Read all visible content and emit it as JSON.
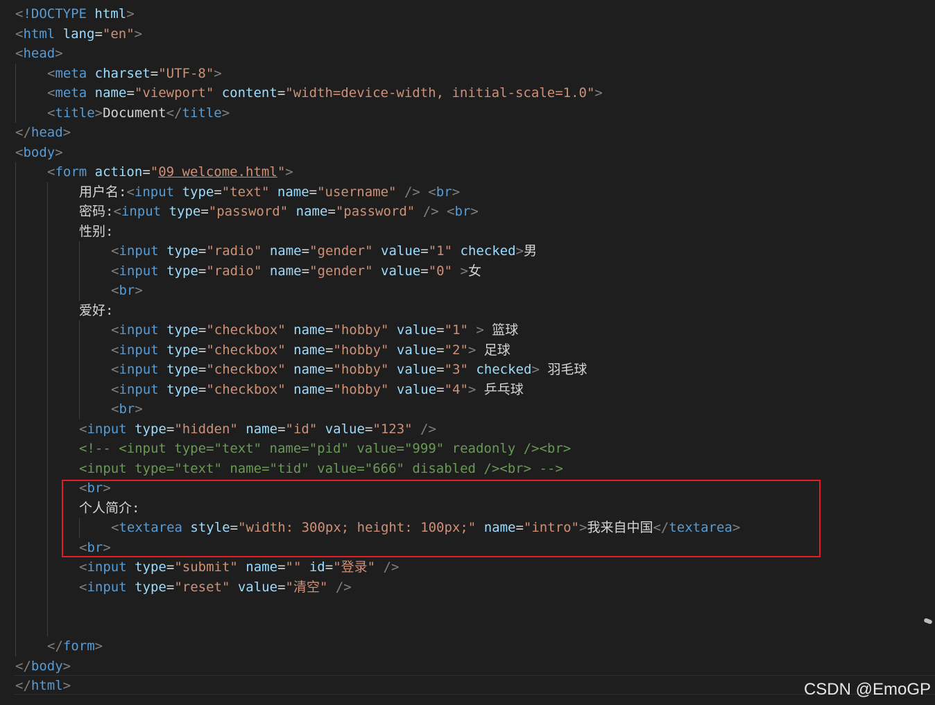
{
  "editor": {
    "lines": [
      {
        "indent": 0,
        "tokens": [
          [
            "p",
            "<"
          ],
          [
            "t",
            "!DOCTYPE"
          ],
          [
            "x",
            " "
          ],
          [
            "a",
            "html"
          ],
          [
            "p",
            ">"
          ]
        ]
      },
      {
        "indent": 0,
        "tokens": [
          [
            "p",
            "<"
          ],
          [
            "t",
            "html"
          ],
          [
            "x",
            " "
          ],
          [
            "a",
            "lang"
          ],
          [
            "x",
            "="
          ],
          [
            "s",
            "\"en\""
          ],
          [
            "p",
            ">"
          ]
        ]
      },
      {
        "indent": 0,
        "tokens": [
          [
            "p",
            "<"
          ],
          [
            "t",
            "head"
          ],
          [
            "p",
            ">"
          ]
        ]
      },
      {
        "indent": 1,
        "tokens": [
          [
            "p",
            "<"
          ],
          [
            "t",
            "meta"
          ],
          [
            "x",
            " "
          ],
          [
            "a",
            "charset"
          ],
          [
            "x",
            "="
          ],
          [
            "s",
            "\"UTF-8\""
          ],
          [
            "p",
            ">"
          ]
        ]
      },
      {
        "indent": 1,
        "tokens": [
          [
            "p",
            "<"
          ],
          [
            "t",
            "meta"
          ],
          [
            "x",
            " "
          ],
          [
            "a",
            "name"
          ],
          [
            "x",
            "="
          ],
          [
            "s",
            "\"viewport\""
          ],
          [
            "x",
            " "
          ],
          [
            "a",
            "content"
          ],
          [
            "x",
            "="
          ],
          [
            "s",
            "\"width=device-width, initial-scale=1.0\""
          ],
          [
            "p",
            ">"
          ]
        ]
      },
      {
        "indent": 1,
        "tokens": [
          [
            "p",
            "<"
          ],
          [
            "t",
            "title"
          ],
          [
            "p",
            ">"
          ],
          [
            "x",
            "Document"
          ],
          [
            "p",
            "</"
          ],
          [
            "t",
            "title"
          ],
          [
            "p",
            ">"
          ]
        ]
      },
      {
        "indent": 0,
        "tokens": [
          [
            "p",
            "</"
          ],
          [
            "t",
            "head"
          ],
          [
            "p",
            ">"
          ]
        ]
      },
      {
        "indent": 0,
        "tokens": [
          [
            "p",
            "<"
          ],
          [
            "t",
            "body"
          ],
          [
            "p",
            ">"
          ]
        ]
      },
      {
        "indent": 1,
        "tokens": [
          [
            "p",
            "<"
          ],
          [
            "t",
            "form"
          ],
          [
            "x",
            " "
          ],
          [
            "a",
            "action"
          ],
          [
            "x",
            "="
          ],
          [
            "s",
            "\""
          ],
          [
            "su",
            "09 welcome.html"
          ],
          [
            "s",
            "\""
          ],
          [
            "p",
            ">"
          ]
        ]
      },
      {
        "indent": 2,
        "tokens": [
          [
            "x",
            "用户名:"
          ],
          [
            "p",
            "<"
          ],
          [
            "t",
            "input"
          ],
          [
            "x",
            " "
          ],
          [
            "a",
            "type"
          ],
          [
            "x",
            "="
          ],
          [
            "s",
            "\"text\""
          ],
          [
            "x",
            " "
          ],
          [
            "a",
            "name"
          ],
          [
            "x",
            "="
          ],
          [
            "s",
            "\"username\""
          ],
          [
            "x",
            " "
          ],
          [
            "p",
            "/>"
          ],
          [
            "x",
            " "
          ],
          [
            "p",
            "<"
          ],
          [
            "t",
            "br"
          ],
          [
            "p",
            ">"
          ]
        ]
      },
      {
        "indent": 2,
        "tokens": [
          [
            "x",
            "密码:"
          ],
          [
            "p",
            "<"
          ],
          [
            "t",
            "input"
          ],
          [
            "x",
            " "
          ],
          [
            "a",
            "type"
          ],
          [
            "x",
            "="
          ],
          [
            "s",
            "\"password\""
          ],
          [
            "x",
            " "
          ],
          [
            "a",
            "name"
          ],
          [
            "x",
            "="
          ],
          [
            "s",
            "\"password\""
          ],
          [
            "x",
            " "
          ],
          [
            "p",
            "/>"
          ],
          [
            "x",
            " "
          ],
          [
            "p",
            "<"
          ],
          [
            "t",
            "br"
          ],
          [
            "p",
            ">"
          ]
        ]
      },
      {
        "indent": 2,
        "tokens": [
          [
            "x",
            "性别:"
          ]
        ]
      },
      {
        "indent": 3,
        "tokens": [
          [
            "p",
            "<"
          ],
          [
            "t",
            "input"
          ],
          [
            "x",
            " "
          ],
          [
            "a",
            "type"
          ],
          [
            "x",
            "="
          ],
          [
            "s",
            "\"radio\""
          ],
          [
            "x",
            " "
          ],
          [
            "a",
            "name"
          ],
          [
            "x",
            "="
          ],
          [
            "s",
            "\"gender\""
          ],
          [
            "x",
            " "
          ],
          [
            "a",
            "value"
          ],
          [
            "x",
            "="
          ],
          [
            "s",
            "\"1\""
          ],
          [
            "x",
            " "
          ],
          [
            "a",
            "checked"
          ],
          [
            "p",
            ">"
          ],
          [
            "x",
            "男"
          ]
        ]
      },
      {
        "indent": 3,
        "tokens": [
          [
            "p",
            "<"
          ],
          [
            "t",
            "input"
          ],
          [
            "x",
            " "
          ],
          [
            "a",
            "type"
          ],
          [
            "x",
            "="
          ],
          [
            "s",
            "\"radio\""
          ],
          [
            "x",
            " "
          ],
          [
            "a",
            "name"
          ],
          [
            "x",
            "="
          ],
          [
            "s",
            "\"gender\""
          ],
          [
            "x",
            " "
          ],
          [
            "a",
            "value"
          ],
          [
            "x",
            "="
          ],
          [
            "s",
            "\"0\""
          ],
          [
            "x",
            " "
          ],
          [
            "p",
            ">"
          ],
          [
            "x",
            "女"
          ]
        ]
      },
      {
        "indent": 3,
        "tokens": [
          [
            "p",
            "<"
          ],
          [
            "t",
            "br"
          ],
          [
            "p",
            ">"
          ]
        ]
      },
      {
        "indent": 2,
        "tokens": [
          [
            "x",
            "爱好:"
          ]
        ]
      },
      {
        "indent": 3,
        "tokens": [
          [
            "p",
            "<"
          ],
          [
            "t",
            "input"
          ],
          [
            "x",
            " "
          ],
          [
            "a",
            "type"
          ],
          [
            "x",
            "="
          ],
          [
            "s",
            "\"checkbox\""
          ],
          [
            "x",
            " "
          ],
          [
            "a",
            "name"
          ],
          [
            "x",
            "="
          ],
          [
            "s",
            "\"hobby\""
          ],
          [
            "x",
            " "
          ],
          [
            "a",
            "value"
          ],
          [
            "x",
            "="
          ],
          [
            "s",
            "\"1\""
          ],
          [
            "x",
            " "
          ],
          [
            "p",
            ">"
          ],
          [
            "x",
            " 篮球"
          ]
        ]
      },
      {
        "indent": 3,
        "tokens": [
          [
            "p",
            "<"
          ],
          [
            "t",
            "input"
          ],
          [
            "x",
            " "
          ],
          [
            "a",
            "type"
          ],
          [
            "x",
            "="
          ],
          [
            "s",
            "\"checkbox\""
          ],
          [
            "x",
            " "
          ],
          [
            "a",
            "name"
          ],
          [
            "x",
            "="
          ],
          [
            "s",
            "\"hobby\""
          ],
          [
            "x",
            " "
          ],
          [
            "a",
            "value"
          ],
          [
            "x",
            "="
          ],
          [
            "s",
            "\"2\""
          ],
          [
            "p",
            ">"
          ],
          [
            "x",
            " 足球"
          ]
        ]
      },
      {
        "indent": 3,
        "tokens": [
          [
            "p",
            "<"
          ],
          [
            "t",
            "input"
          ],
          [
            "x",
            " "
          ],
          [
            "a",
            "type"
          ],
          [
            "x",
            "="
          ],
          [
            "s",
            "\"checkbox\""
          ],
          [
            "x",
            " "
          ],
          [
            "a",
            "name"
          ],
          [
            "x",
            "="
          ],
          [
            "s",
            "\"hobby\""
          ],
          [
            "x",
            " "
          ],
          [
            "a",
            "value"
          ],
          [
            "x",
            "="
          ],
          [
            "s",
            "\"3\""
          ],
          [
            "x",
            " "
          ],
          [
            "a",
            "checked"
          ],
          [
            "p",
            ">"
          ],
          [
            "x",
            " 羽毛球"
          ]
        ]
      },
      {
        "indent": 3,
        "tokens": [
          [
            "p",
            "<"
          ],
          [
            "t",
            "input"
          ],
          [
            "x",
            " "
          ],
          [
            "a",
            "type"
          ],
          [
            "x",
            "="
          ],
          [
            "s",
            "\"checkbox\""
          ],
          [
            "x",
            " "
          ],
          [
            "a",
            "name"
          ],
          [
            "x",
            "="
          ],
          [
            "s",
            "\"hobby\""
          ],
          [
            "x",
            " "
          ],
          [
            "a",
            "value"
          ],
          [
            "x",
            "="
          ],
          [
            "s",
            "\"4\""
          ],
          [
            "p",
            ">"
          ],
          [
            "x",
            " 乒乓球"
          ]
        ]
      },
      {
        "indent": 3,
        "tokens": [
          [
            "p",
            "<"
          ],
          [
            "t",
            "br"
          ],
          [
            "p",
            ">"
          ]
        ]
      },
      {
        "indent": 2,
        "tokens": [
          [
            "p",
            "<"
          ],
          [
            "t",
            "input"
          ],
          [
            "x",
            " "
          ],
          [
            "a",
            "type"
          ],
          [
            "x",
            "="
          ],
          [
            "s",
            "\"hidden\""
          ],
          [
            "x",
            " "
          ],
          [
            "a",
            "name"
          ],
          [
            "x",
            "="
          ],
          [
            "s",
            "\"id\""
          ],
          [
            "x",
            " "
          ],
          [
            "a",
            "value"
          ],
          [
            "x",
            "="
          ],
          [
            "s",
            "\"123\""
          ],
          [
            "x",
            " "
          ],
          [
            "p",
            "/>"
          ]
        ]
      },
      {
        "indent": 2,
        "tokens": [
          [
            "c",
            "<!-- <input type=\"text\" name=\"pid\" value=\"999\" readonly /><br>"
          ]
        ]
      },
      {
        "indent": 2,
        "tokens": [
          [
            "c",
            "<input type=\"text\" name=\"tid\" value=\"666\" disabled /><br> -->"
          ]
        ]
      },
      {
        "indent": 2,
        "tokens": [
          [
            "p",
            "<"
          ],
          [
            "t",
            "br"
          ],
          [
            "p",
            ">"
          ]
        ]
      },
      {
        "indent": 2,
        "tokens": [
          [
            "x",
            "个人简介:"
          ]
        ]
      },
      {
        "indent": 3,
        "tokens": [
          [
            "p",
            "<"
          ],
          [
            "t",
            "textarea"
          ],
          [
            "x",
            " "
          ],
          [
            "a",
            "style"
          ],
          [
            "x",
            "="
          ],
          [
            "s",
            "\"width: 300px; height: 100px;\""
          ],
          [
            "x",
            " "
          ],
          [
            "a",
            "name"
          ],
          [
            "x",
            "="
          ],
          [
            "s",
            "\"intro\""
          ],
          [
            "p",
            ">"
          ],
          [
            "x",
            "我来自中国"
          ],
          [
            "p",
            "</"
          ],
          [
            "t",
            "textarea"
          ],
          [
            "p",
            ">"
          ]
        ]
      },
      {
        "indent": 2,
        "tokens": [
          [
            "p",
            "<"
          ],
          [
            "t",
            "br"
          ],
          [
            "p",
            ">"
          ]
        ]
      },
      {
        "indent": 2,
        "tokens": [
          [
            "p",
            "<"
          ],
          [
            "t",
            "input"
          ],
          [
            "x",
            " "
          ],
          [
            "a",
            "type"
          ],
          [
            "x",
            "="
          ],
          [
            "s",
            "\"submit\""
          ],
          [
            "x",
            " "
          ],
          [
            "a",
            "name"
          ],
          [
            "x",
            "="
          ],
          [
            "s",
            "\"\""
          ],
          [
            "x",
            " "
          ],
          [
            "a",
            "id"
          ],
          [
            "x",
            "="
          ],
          [
            "s",
            "\"登录\""
          ],
          [
            "x",
            " "
          ],
          [
            "p",
            "/>"
          ]
        ]
      },
      {
        "indent": 2,
        "tokens": [
          [
            "p",
            "<"
          ],
          [
            "t",
            "input"
          ],
          [
            "x",
            " "
          ],
          [
            "a",
            "type"
          ],
          [
            "x",
            "="
          ],
          [
            "s",
            "\"reset\""
          ],
          [
            "x",
            " "
          ],
          [
            "a",
            "value"
          ],
          [
            "x",
            "="
          ],
          [
            "s",
            "\"清空\""
          ],
          [
            "x",
            " "
          ],
          [
            "p",
            "/>"
          ]
        ]
      },
      {
        "indent": 2,
        "tokens": []
      },
      {
        "indent": 2,
        "tokens": []
      },
      {
        "indent": 1,
        "tokens": [
          [
            "p",
            "</"
          ],
          [
            "t",
            "form"
          ],
          [
            "p",
            ">"
          ]
        ]
      },
      {
        "indent": 0,
        "tokens": [
          [
            "p",
            "</"
          ],
          [
            "t",
            "body"
          ],
          [
            "p",
            ">"
          ]
        ]
      },
      {
        "indent": 0,
        "tokens": [
          [
            "p",
            "</"
          ],
          [
            "t",
            "html"
          ],
          [
            "p",
            ">"
          ]
        ]
      }
    ]
  },
  "watermark": {
    "text": "CSDN @EmoGP"
  },
  "colors": {
    "background": "#1e1e1e",
    "punctuation": "#808080",
    "tag": "#569cd6",
    "attribute": "#9cdcfe",
    "string": "#ce9178",
    "comment": "#6a9955",
    "text": "#d4d4d4",
    "highlight_box": "#e51c23"
  }
}
